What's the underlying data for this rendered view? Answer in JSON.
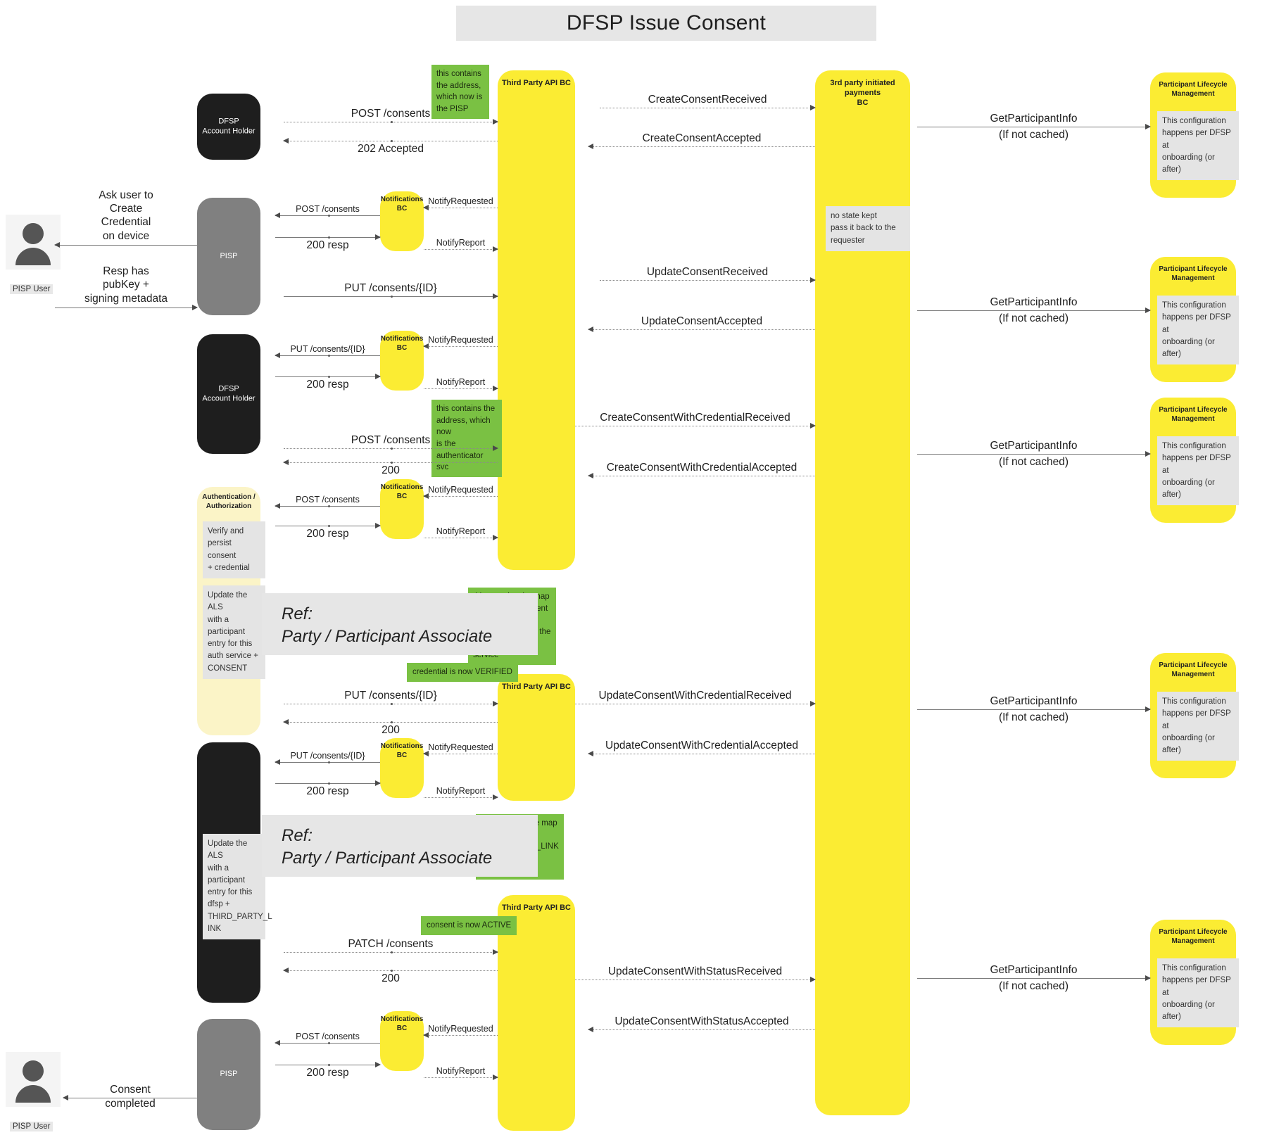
{
  "title": "DFSP Issue Consent",
  "actors": {
    "top_user_label": "PISP User",
    "bottom_user_label": "PISP User"
  },
  "lifelines": {
    "dfsp1": "DFSP\nAccount Holder",
    "pisp1": "PISP",
    "dfsp2": "DFSP\nAccount Holder",
    "auth": "Authentication /\nAuthorization",
    "dfsp3": "DFSP\nAccount Holder",
    "pisp2": "PISP",
    "tpapi1": "Third Party API BC",
    "tpapi2": "Third Party API BC",
    "tpapi3": "Third Party API BC",
    "notif": "Notifications\nBC",
    "tpip": "3rd party initiated payments\nBC",
    "plm": "Participant Lifecycle\nManagement"
  },
  "notes": {
    "green_address_pisp": "this contains\nthe address,\nwhich now is\nthe PISP",
    "green_address_auth": "this contains the\naddress, which now\nis the authenticator\nsvc",
    "green_map_consent": "this contains the map\nbetween the consent (id)\nand the FSP ID of the auth\nservice",
    "green_map_tpl": "this contains the map\nbetween the\nTHIRD_PARTY_LINK and\nthe FSP ID",
    "green_verified": "credential is now VERIFIED",
    "green_active": "consent is now ACTIVE",
    "tpip_no_state": "no state kept\npass it back to the\nrequester",
    "plm_config": "This configuration\nhappens per DFSP at\nonboarding (or after)",
    "auth_verify": "Verify and\npersist consent\n+ credential",
    "auth_als": "Update the ALS\nwith a\nparticipant\nentry for this\nauth service +\nCONSENT",
    "dfsp_als": "Update the ALS\nwith a\nparticipant\nentry for this\ndfsp +\nTHIRD_PARTY_L\nINK"
  },
  "refs": {
    "keyword": "Ref:",
    "ref1": "Party / Participant Associate",
    "ref2": "Party / Participant Associate"
  },
  "messages": {
    "ask_user": "Ask user to\nCreate\nCredential\non device",
    "resp_pubkey": "Resp has\npubKey +\nsigning metadata",
    "consent_completed": "Consent\ncompleted",
    "post_consents": "POST /consents",
    "accepted_202": "202 Accepted",
    "resp_200": "200 resp",
    "put_consents_id": "PUT /consents/{ID}",
    "status_200": "200",
    "patch_consents": "PATCH /consents",
    "notify_requested": "NotifyRequested",
    "notify_report": "NotifyReport",
    "create_consent_received": "CreateConsentReceived",
    "create_consent_accepted": "CreateConsentAccepted",
    "update_consent_received": "UpdateConsentReceived",
    "update_consent_accepted": "UpdateConsentAccepted",
    "create_consent_cred_received": "CreateConsentWithCredentialReceived",
    "create_consent_cred_accepted": "CreateConsentWithCredentialAccepted",
    "update_consent_cred_received": "UpdateConsentWithCredentialReceived",
    "update_consent_cred_accepted": "UpdateConsentWithCredentialAccepted",
    "update_consent_status_received": "UpdateConsentWithStatusReceived",
    "update_consent_status_accepted": "UpdateConsentWithStatusAccepted",
    "get_participant_info": "GetParticipantInfo",
    "if_not_cached": "(If not cached)"
  },
  "colors": {
    "yellow": "#fbec33",
    "green": "#7ac143",
    "black": "#1e1e1e",
    "gray": "#808080",
    "cream": "#fbf4c7",
    "note_gray": "#e4e4e4",
    "title_bg": "#e6e6e6"
  }
}
